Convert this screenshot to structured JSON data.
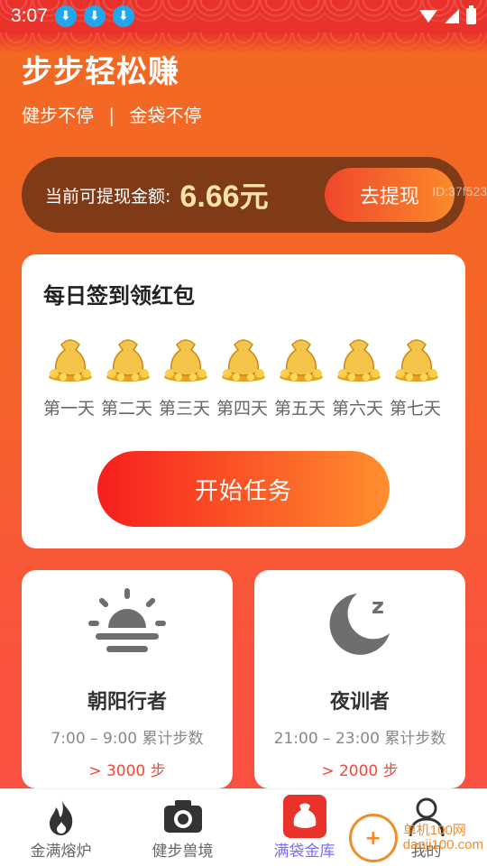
{
  "status_bar": {
    "time": "3:07"
  },
  "hero": {
    "title": "步步轻松赚",
    "subtitle_left": "健步不停",
    "subtitle_sep": "|",
    "subtitle_right": "金袋不停"
  },
  "balance": {
    "label": "当前可提现金额:",
    "amount": "6.66",
    "unit": "元",
    "withdraw_label": "去提现",
    "id_text": "ID:37f523"
  },
  "checkin": {
    "title": "每日签到领红包",
    "days": [
      "第一天",
      "第二天",
      "第三天",
      "第四天",
      "第五天",
      "第六天",
      "第七天"
    ],
    "start_label": "开始任务"
  },
  "walkers": [
    {
      "name": "朝阳行者",
      "time": "7:00 – 9:00 累计步数",
      "goal": "> 3000 步",
      "icon": "sunrise-icon"
    },
    {
      "name": "夜训者",
      "time": "21:00 – 23:00 累计步数",
      "goal": "> 2000 步",
      "icon": "moon-sleep-icon"
    }
  ],
  "nav": {
    "items": [
      {
        "label": "金满熔炉",
        "icon": "fire-icon"
      },
      {
        "label": "健步兽境",
        "icon": "camera-icon"
      },
      {
        "label": "满袋金库",
        "icon": "money-bag-icon"
      },
      {
        "label": "我的",
        "icon": "user-icon"
      }
    ],
    "active_index": 2,
    "active_color": "#7a6bff"
  },
  "watermark": {
    "line1": "单机100网",
    "line2": "danji100.com"
  },
  "colors": {
    "accent": "#f26a22",
    "balance_bg": "#7f3a18",
    "amount": "#ffe2a8"
  }
}
